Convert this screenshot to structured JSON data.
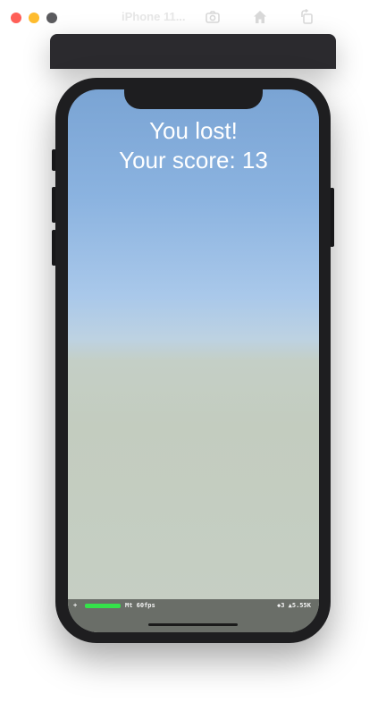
{
  "window": {
    "title": "iPhone 11...",
    "toolbar": {
      "screenshot_icon": "screenshot-icon",
      "home_icon": "home-icon",
      "rotate_icon": "rotate-icon"
    }
  },
  "game": {
    "lost_message": "You lost!",
    "score_message": "Your score: 13"
  },
  "stats": {
    "plus": "+",
    "fps_label": "Mt 60fps",
    "right_label": "◆3 ▲5.55K",
    "fps_bar_color": "#34e24a"
  }
}
